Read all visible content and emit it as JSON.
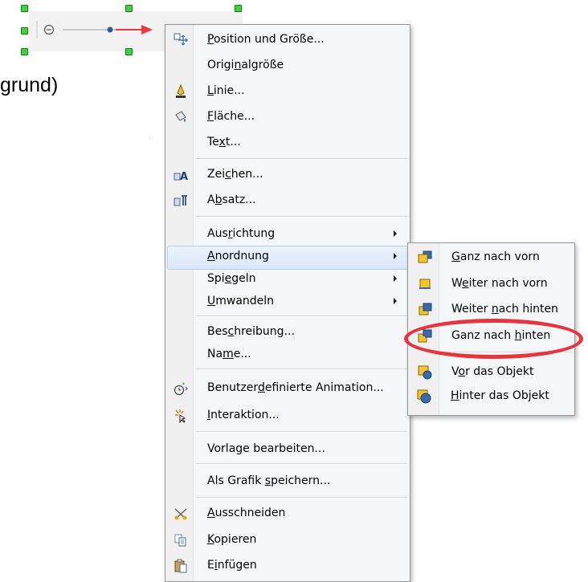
{
  "background_text": "grund)",
  "main_menu": {
    "items": [
      {
        "id": "position-und-groesse",
        "pre": "",
        "u": "P",
        "post": "osition und Größe...",
        "icon": "position-size-icon"
      },
      {
        "id": "originalgroesse",
        "pre": "Origi",
        "u": "n",
        "post": "algröße",
        "icon": ""
      },
      {
        "id": "linie",
        "pre": "",
        "u": "L",
        "post": "inie...",
        "icon": "line-icon"
      },
      {
        "id": "flaeche",
        "pre": "",
        "u": "F",
        "post": "läche...",
        "icon": "area-fill-icon"
      },
      {
        "id": "text",
        "pre": "Te",
        "u": "x",
        "post": "t...",
        "icon": ""
      },
      {
        "id": "zeichen",
        "pre": "Zei",
        "u": "c",
        "post": "hen...",
        "icon": "character-icon"
      },
      {
        "id": "absatz",
        "pre": "A",
        "u": "b",
        "post": "satz...",
        "icon": "paragraph-icon"
      },
      {
        "id": "ausrichtung",
        "pre": "Aus",
        "u": "r",
        "post": "ichtung",
        "icon": ""
      },
      {
        "id": "anordnung",
        "pre": "",
        "u": "A",
        "post": "nordnung",
        "icon": ""
      },
      {
        "id": "spiegeln",
        "pre": "Spi",
        "u": "e",
        "post": "geln",
        "icon": ""
      },
      {
        "id": "umwandeln",
        "pre": "",
        "u": "U",
        "post": "mwandeln",
        "icon": ""
      },
      {
        "id": "beschreibung",
        "pre": "Bes",
        "u": "c",
        "post": "hreibung...",
        "icon": ""
      },
      {
        "id": "name",
        "pre": "Na",
        "u": "m",
        "post": "e...",
        "icon": ""
      },
      {
        "id": "benutzerdefinierte-animation",
        "pre": "Benutzer",
        "u": "d",
        "post": "efinierte Animation...",
        "icon": "custom-animation-icon"
      },
      {
        "id": "interaktion",
        "pre": "",
        "u": "I",
        "post": "nteraktion...",
        "icon": "interaction-icon"
      },
      {
        "id": "vorlage-bearbeiten",
        "pre": "Vorla",
        "u": "g",
        "post": "e bearbeiten...",
        "icon": ""
      },
      {
        "id": "als-grafik-speichern",
        "pre": "Als Grafik ",
        "u": "s",
        "post": "peichern...",
        "icon": ""
      },
      {
        "id": "ausschneiden",
        "pre": "",
        "u": "A",
        "post": "usschneiden",
        "icon": "scissors-icon"
      },
      {
        "id": "kopieren",
        "pre": "",
        "u": "K",
        "post": "opieren",
        "icon": "copy-icon"
      },
      {
        "id": "einfuegen",
        "pre": "E",
        "u": "i",
        "post": "nfügen",
        "icon": "paste-icon"
      }
    ]
  },
  "submenu": {
    "items": [
      {
        "id": "ganz-nach-vorn",
        "pre": "",
        "u": "G",
        "post": "anz nach vorn",
        "icon": "bring-to-front-icon"
      },
      {
        "id": "weiter-nach-vorn",
        "pre": "W",
        "u": "e",
        "post": "iter nach vorn",
        "icon": "bring-forward-icon"
      },
      {
        "id": "weiter-nach-hinten",
        "pre": "Weiter ",
        "u": "n",
        "post": "ach hinten",
        "icon": "send-backward-icon"
      },
      {
        "id": "ganz-nach-hinten",
        "pre": "Ganz nach ",
        "u": "h",
        "post": "inten",
        "icon": "send-to-back-icon"
      },
      {
        "id": "vor-das-objekt",
        "pre": "V",
        "u": "o",
        "post": "r das Objekt",
        "icon": "in-front-of-object-icon"
      },
      {
        "id": "hinter-das-objekt",
        "pre": "",
        "u": "H",
        "post": "inter das Objekt",
        "icon": "behind-object-icon"
      }
    ]
  },
  "colors": {
    "highlight_ring": "#e5353f",
    "handle": "#40d040",
    "accent_arrow": "#e83b3b"
  }
}
